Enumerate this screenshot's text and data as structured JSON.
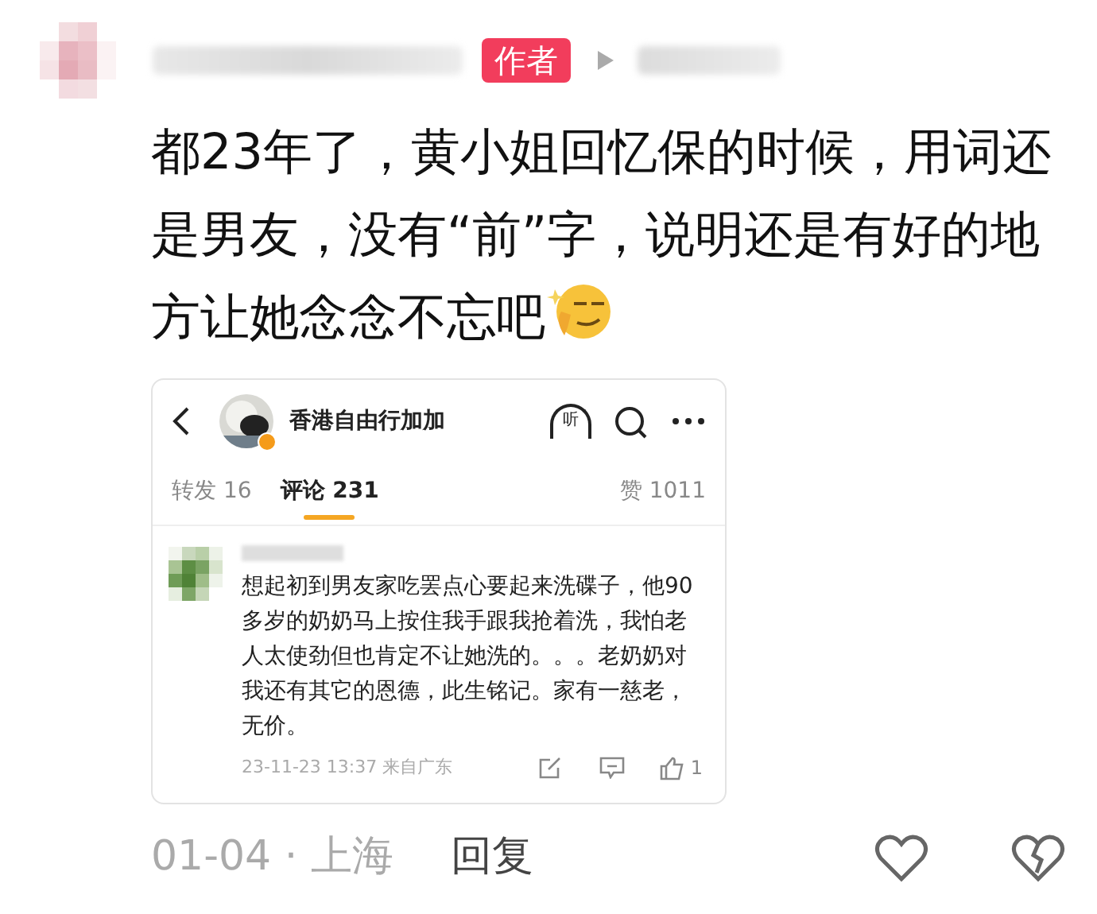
{
  "comment": {
    "badge": "作者",
    "text": "都23年了，黄小姐回忆保的时候，用词还是男友，没有“前”字，说明还是有好的地方让她念念不忘吧",
    "embedded_post": {
      "account_name": "香港自由行加加",
      "listen_label": "听",
      "tabs": [
        {
          "label": "转发 16",
          "selected": false
        },
        {
          "label": "评论 231",
          "selected": true
        }
      ],
      "likes": "赞 1011",
      "reply": {
        "text": "想起初到男友家吃罢点心要起来洗碟子，他90多岁的奶奶马上按住我手跟我抢着洗，我怕老人太使劲但也肯定不让她洗的。。。老奶奶对我还有其它的恩德，此生铭记。家有一慈老，无价。",
        "meta": "23-11-23 13:37 来自广东",
        "like_count": "1"
      }
    },
    "date_location": "01-04 · 上海",
    "reply_button": "回复"
  }
}
